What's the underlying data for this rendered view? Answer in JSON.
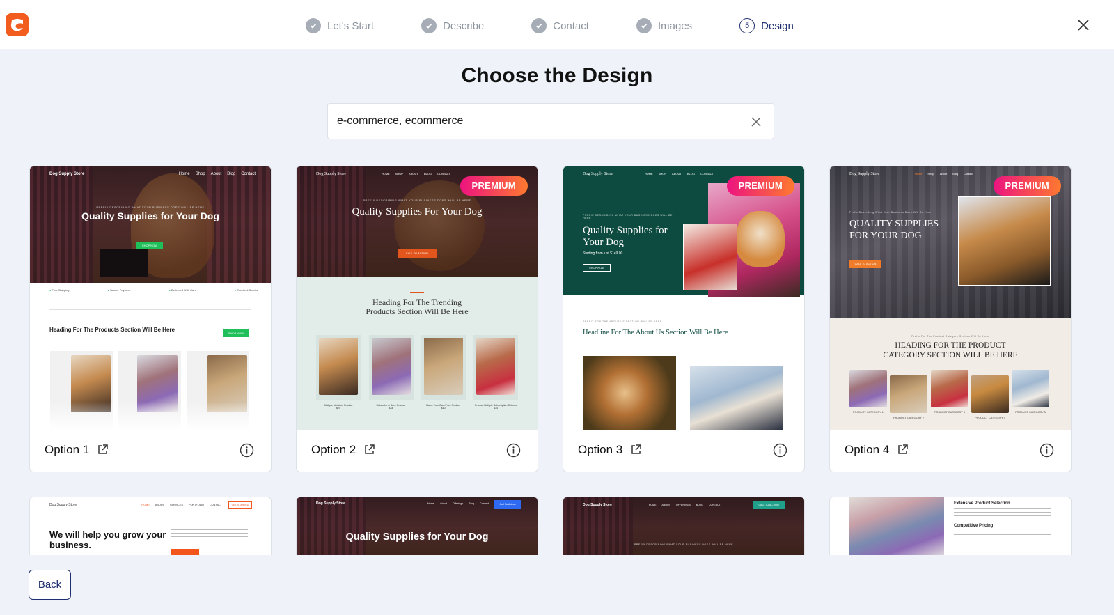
{
  "header": {
    "steps": [
      {
        "label": "Let's Start",
        "state": "done"
      },
      {
        "label": "Describe",
        "state": "done"
      },
      {
        "label": "Contact",
        "state": "done"
      },
      {
        "label": "Images",
        "state": "done"
      },
      {
        "label": "Design",
        "state": "active",
        "number": "5"
      }
    ]
  },
  "page": {
    "title": "Choose the Design",
    "search_value": "e-commerce, ecommerce",
    "back_label": "Back",
    "premium_label": "PREMIUM"
  },
  "cards": [
    {
      "option": "Option 1",
      "premium": false,
      "brand": "Dog Supply Store",
      "nav": [
        "Home",
        "Shop",
        "About",
        "Blog",
        "Contact"
      ],
      "eyebrow": "PREFIX DESCRIBING WHAT YOUR BUSINESS DOES WILL BE HERE",
      "heading": "Quality Supplies for Your Dog",
      "cta": "SHOP NOW",
      "features": [
        "Free Shipping",
        "Secure Payment",
        "Delivered With Care",
        "Excellent Service"
      ],
      "section": "Heading For The Products Section Will Be Here",
      "section_cta": "SHOP NOW"
    },
    {
      "option": "Option 2",
      "premium": true,
      "brand": "Dog Supply Store",
      "nav": [
        "HOME",
        "SHOP",
        "ABOUT",
        "BLOG",
        "CONTACT"
      ],
      "eyebrow": "PREFIX DESCRIBING WHAT YOUR BUSINESS DOES WILL BE HERE",
      "heading": "Quality Supplies For Your Dog",
      "cta": "CALL TO ACTION",
      "section": "Heading For The Trending Products Section Will Be Here",
      "products": [
        "Multiple Variation Product",
        "Subscribe & Save Product",
        "Name Your Own Price Product",
        "Product Multiple Subscription Options"
      ],
      "prices": [
        "$24",
        "$34",
        "$10",
        "$34"
      ]
    },
    {
      "option": "Option 3",
      "premium": true,
      "brand": "Dog Supply Store",
      "nav": [
        "HOME",
        "SHOP",
        "ABOUT",
        "BLOG",
        "CONTACT"
      ],
      "eyebrow": "PREFIX DESCRIBING WHAT YOUR BUSINESS DOES WILL BE HERE",
      "heading": "Quality Supplies for Your Dog",
      "subheading": "Starting from just $149.00",
      "cta": "SHOP NOW",
      "about_eyebrow": "PREFIX FOR THE ABOUT US SECTION WILL BE HERE",
      "section": "Headline For The About Us Section Will Be Here"
    },
    {
      "option": "Option 4",
      "premium": true,
      "brand": "Dog Supply Store",
      "nav": [
        "Home",
        "Shop",
        "About",
        "Blog",
        "Contact"
      ],
      "eyebrow": "Prefix Describing What Your Business Does Will Be Here",
      "heading": "QUALITY SUPPLIES FOR YOUR DOG",
      "cta": "CALL TO ACTION",
      "section_eyebrow": "Prefix For The Product Category Section Will Be Here",
      "section": "HEADING FOR THE PRODUCT CATEGORY SECTION WILL BE HERE",
      "categories": [
        "PRODUCT CATEGORY 1",
        "PRODUCT CATEGORY 2",
        "PRODUCT CATEGORY 3",
        "PRODUCT CATEGORY 4",
        "PRODUCT CATEGORY 5"
      ]
    }
  ],
  "row2": [
    {
      "brand": "Dog Supply Store",
      "nav": [
        "HOME",
        "ABOUT",
        "SERVICES",
        "PORTFOLIO",
        "CONTACT"
      ],
      "cta": "GET STARTED",
      "heading": "We will help you grow your business."
    },
    {
      "brand": "Dog Supply Store",
      "nav": [
        "Home",
        "About",
        "Offerings",
        "Blog",
        "Contact"
      ],
      "cta": "Call To Action",
      "heading": "Quality Supplies for Your Dog"
    },
    {
      "brand": "Dog Supply Store",
      "nav": [
        "HOME",
        "ABOUT",
        "OFFERINGS",
        "BLOG",
        "CONTACT"
      ],
      "cta": "CALL TO ACTION",
      "eyebrow": "PREFIX DESCRIBING WHAT YOUR BUSINESS DOES WILL BE HERE"
    },
    {
      "title1": "Extensive Product Selection",
      "title2": "Competitive Pricing"
    }
  ],
  "colors": {
    "accent_navy": "#1e2f6f",
    "logo_orange": "#f25c1f",
    "premium_start": "#ec1380",
    "premium_end": "#ff7a2f",
    "page_bg": "#eff3f9"
  }
}
